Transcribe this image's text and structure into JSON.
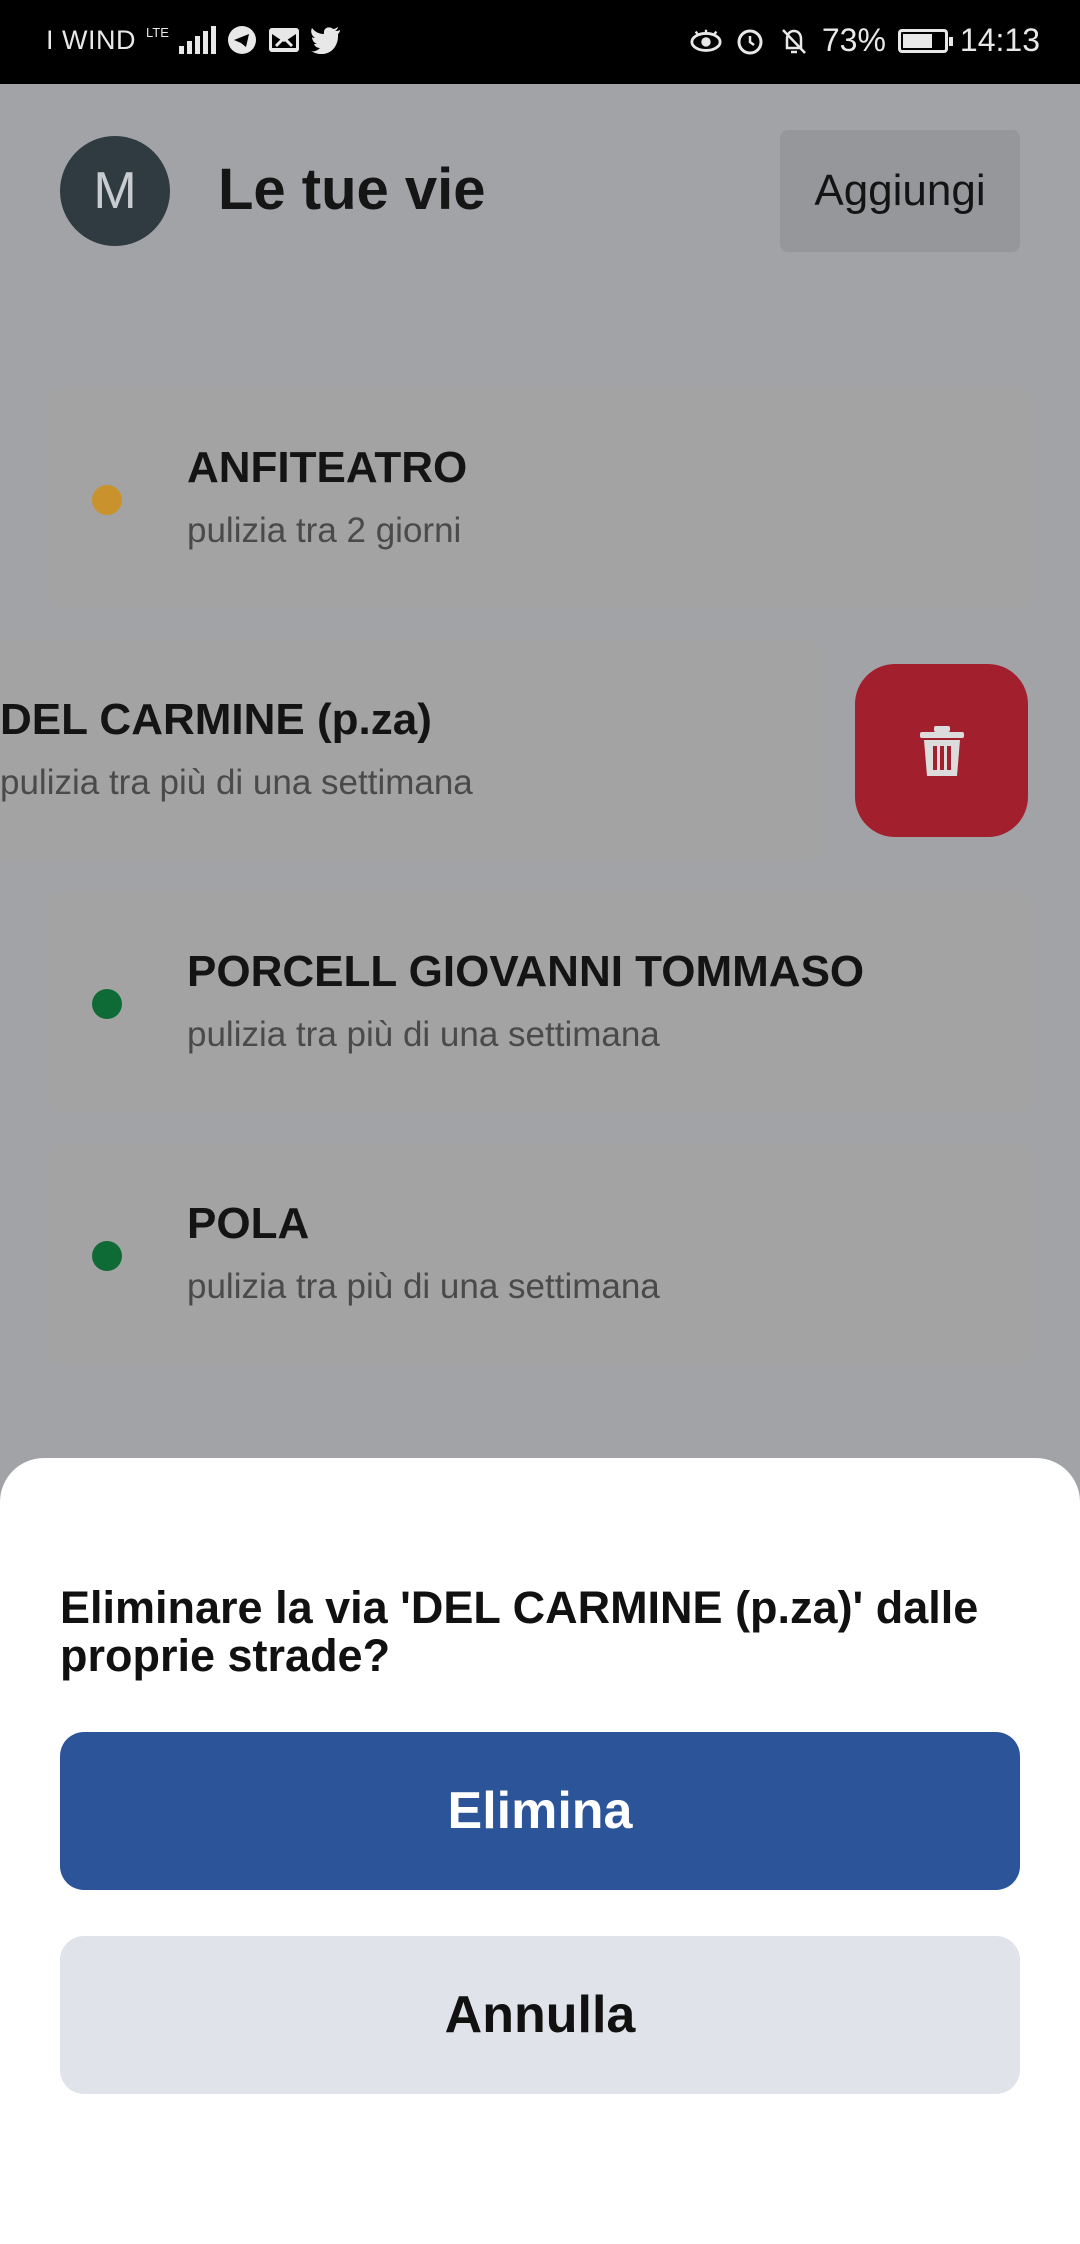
{
  "status_bar": {
    "carrier": "I WIND",
    "network": "LTE",
    "battery": "73%",
    "battery_level": 0.73,
    "time": "14:13",
    "icons": [
      "signal-icon",
      "telegram-icon",
      "mail-icon",
      "twitter-icon",
      "eye-icon",
      "alarm-icon",
      "bell-off-icon",
      "battery-icon"
    ]
  },
  "header": {
    "avatar_letter": "M",
    "title": "Le tue vie",
    "add_label": "Aggiungi"
  },
  "streets": [
    {
      "name": "ANFITEATRO",
      "status": "pulizia tra 2 giorni",
      "dot_color": "#c9922d"
    },
    {
      "name": "DEL CARMINE (p.za)",
      "status": "pulizia tra più di una settimana",
      "dot_color": ""
    },
    {
      "name": "PORCELL GIOVANNI TOMMASO",
      "status": "pulizia tra più di una settimana",
      "dot_color": "#0f6b35"
    },
    {
      "name": "POLA",
      "status": "pulizia tra più di una settimana",
      "dot_color": "#0f6b35"
    }
  ],
  "delete_action": {
    "icon": "trash-icon",
    "color": "#a21f2e"
  },
  "dialog": {
    "question": "Eliminare la via 'DEL CARMINE (p.za)' dalle proprie strade?",
    "confirm_label": "Elimina",
    "cancel_label": "Annulla",
    "confirm_color": "#2c5599"
  }
}
